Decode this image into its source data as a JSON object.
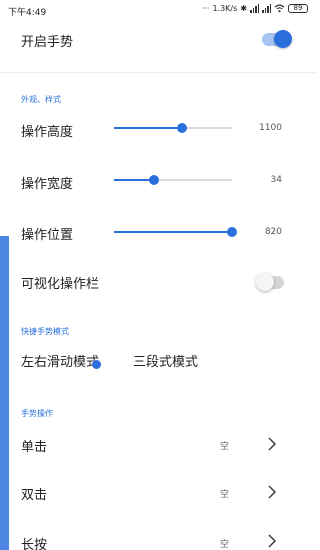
{
  "status_bar": {
    "time": "下午4:49",
    "network_speed": "1.3K/s",
    "battery": "89"
  },
  "gesture_toggle": {
    "label": "开启手势",
    "on": true
  },
  "appearance": {
    "header": "外观、样式",
    "sliders": [
      {
        "label": "操作高度",
        "value": "1100",
        "fraction": 0.58
      },
      {
        "label": "操作宽度",
        "value": "34",
        "fraction": 0.34
      },
      {
        "label": "操作位置",
        "value": "820",
        "fraction": 1.0
      }
    ],
    "visual_bar": {
      "label": "可视化操作栏",
      "on": false
    }
  },
  "quick_mode": {
    "header": "快捷手势模式",
    "options": [
      {
        "label": "左右滑动模式",
        "selected": true
      },
      {
        "label": "三段式模式",
        "selected": false
      }
    ]
  },
  "gesture_actions": {
    "header": "手势操作",
    "items": [
      {
        "label": "单击",
        "value": "空"
      },
      {
        "label": "双击",
        "value": "空"
      },
      {
        "label": "长按",
        "value": "空"
      }
    ]
  },
  "colors": {
    "accent": "#2a6fdb",
    "side_bar": "#4d86e3"
  }
}
